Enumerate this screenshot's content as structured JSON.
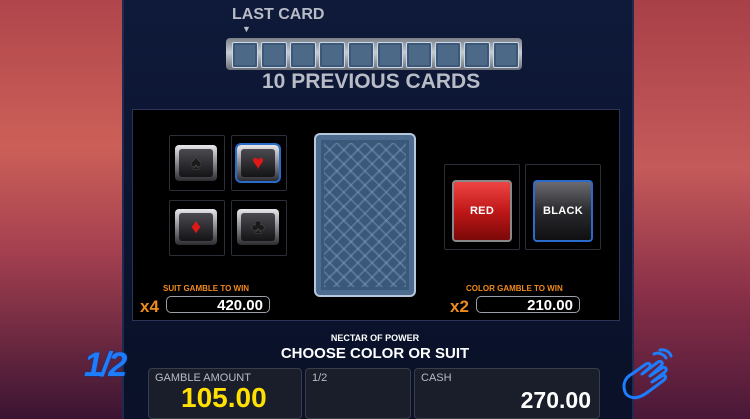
{
  "header": {
    "last_card_label": "LAST CARD",
    "arrow": "▼",
    "previous_cards_title": "10 PREVIOUS CARDS",
    "previous_card_count": 10
  },
  "suits": [
    {
      "name": "spade",
      "glyph": "♠",
      "color": "#1a1a1a",
      "selected": false
    },
    {
      "name": "heart",
      "glyph": "♥",
      "color": "#e01818",
      "selected": true
    },
    {
      "name": "diamond",
      "glyph": "♦",
      "color": "#e01818",
      "selected": false
    },
    {
      "name": "club",
      "glyph": "♣",
      "color": "#1a1a1a",
      "selected": false
    }
  ],
  "suit_gamble": {
    "label": "SUIT GAMBLE TO WIN",
    "multiplier": "x4",
    "value": "420.00"
  },
  "color_gamble": {
    "label": "COLOR GAMBLE TO WIN",
    "multiplier": "x2",
    "value": "210.00",
    "red_label": "RED",
    "black_label": "BLACK"
  },
  "game_name": "NECTAR OF POWER",
  "prompt": "CHOOSE COLOR OR SUIT",
  "bottom": {
    "half_button": "1/2",
    "gamble_amount_label": "GAMBLE AMOUNT",
    "gamble_amount_value": "105.00",
    "half_label": "1/2",
    "cash_label": "CASH",
    "cash_value": "270.00"
  },
  "colors": {
    "accent_orange": "#f08a1c",
    "gamble_value_yellow": "#ffe000",
    "selection_blue": "#2a6ac8"
  }
}
